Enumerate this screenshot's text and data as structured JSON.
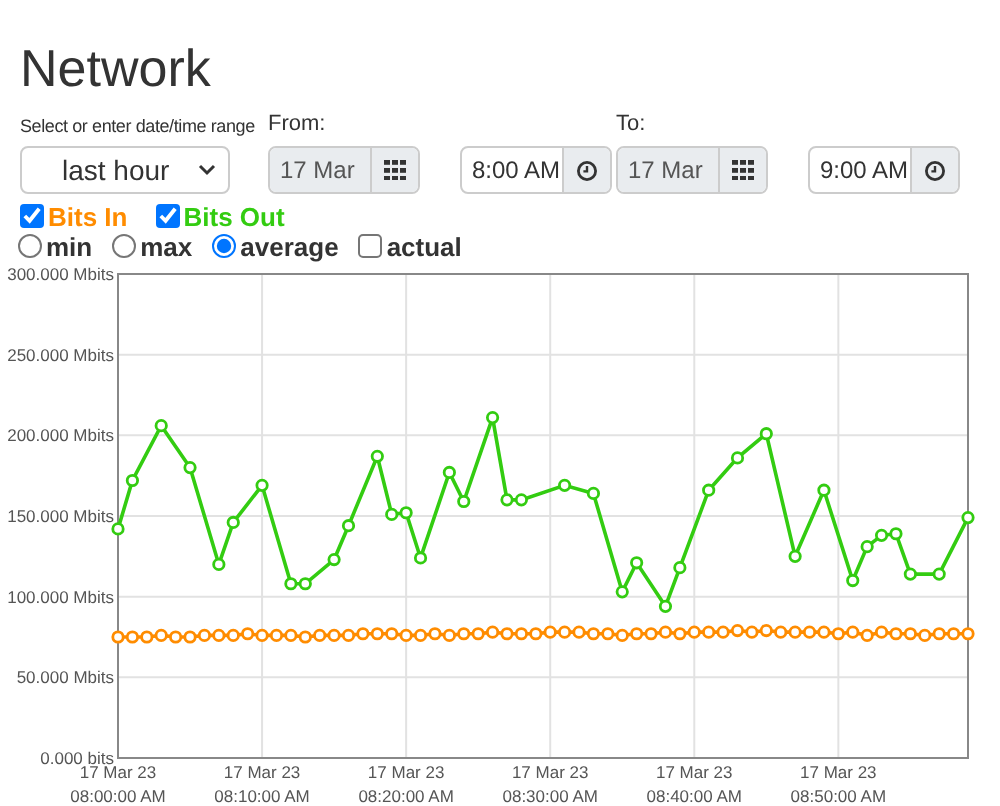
{
  "title": "Network",
  "range": {
    "label": "Select or enter date/time range",
    "value": "last hour"
  },
  "from": {
    "label": "From:",
    "date": "17 Mar",
    "time": "8:00 AM"
  },
  "to": {
    "label": "To:",
    "date": "17 Mar",
    "time": "9:00 AM"
  },
  "series_toggles": [
    {
      "label": "Bits In",
      "checked": true,
      "color": "#ff8c00"
    },
    {
      "label": "Bits Out",
      "checked": true,
      "color": "#33cc11"
    }
  ],
  "modes": [
    {
      "kind": "radio",
      "label": "min",
      "selected": false
    },
    {
      "kind": "radio",
      "label": "max",
      "selected": false
    },
    {
      "kind": "radio",
      "label": "average",
      "selected": true
    },
    {
      "kind": "checkbox",
      "label": "actual",
      "selected": false
    }
  ],
  "chart_data": {
    "type": "line",
    "grid": true,
    "ylim": [
      0,
      300
    ],
    "categories": [
      "17 Mar 23\n08:00:00 AM",
      null,
      null,
      null,
      null,
      null,
      null,
      null,
      null,
      null,
      "17 Mar 23\n08:10:00 AM",
      null,
      null,
      null,
      null,
      null,
      null,
      null,
      null,
      null,
      "17 Mar 23\n08:20:00 AM",
      null,
      null,
      null,
      null,
      null,
      null,
      null,
      null,
      null,
      "17 Mar 23\n08:30:00 AM",
      null,
      null,
      null,
      null,
      null,
      null,
      null,
      null,
      null,
      "17 Mar 23\n08:40:00 AM",
      null,
      null,
      null,
      null,
      null,
      null,
      null,
      null,
      null,
      "17 Mar 23\n08:50:00 AM",
      null,
      null,
      null,
      null,
      null,
      null,
      null,
      null,
      null
    ],
    "yticks": [
      {
        "value": 0,
        "label": "0.000 bits"
      },
      {
        "value": 50,
        "label": "50.000 Mbits"
      },
      {
        "value": 100,
        "label": "100.000 Mbits"
      },
      {
        "value": 150,
        "label": "150.000 Mbits"
      },
      {
        "value": 200,
        "label": "200.000 Mbits"
      },
      {
        "value": 250,
        "label": "250.000 Mbits"
      },
      {
        "value": 300,
        "label": "300.000 Mbits"
      }
    ],
    "series": [
      {
        "color": "#ff8c00",
        "marker": true,
        "values": [
          75,
          75,
          75,
          76,
          75,
          75,
          76,
          76,
          76,
          77,
          76,
          76,
          76,
          75,
          76,
          76,
          76,
          77,
          77,
          77,
          76,
          76,
          77,
          76,
          77,
          77,
          78,
          77,
          77,
          77,
          78,
          78,
          78,
          77,
          77,
          76,
          77,
          77,
          78,
          77,
          78,
          78,
          78,
          79,
          78,
          79,
          78,
          78,
          78,
          78,
          77,
          78,
          76,
          78,
          77,
          77,
          76,
          77,
          77,
          77
        ]
      },
      {
        "color": "#33cc11",
        "marker": true,
        "values": [
          142,
          172,
          null,
          206,
          null,
          180,
          null,
          120,
          146,
          null,
          169,
          null,
          108,
          108,
          null,
          123,
          144,
          null,
          187,
          151,
          152,
          124,
          null,
          177,
          159,
          null,
          211,
          160,
          160,
          null,
          null,
          169,
          null,
          164,
          null,
          103,
          121,
          null,
          94,
          118,
          null,
          166,
          null,
          186,
          null,
          201,
          null,
          125,
          null,
          166,
          null,
          110,
          131,
          138,
          139,
          114,
          null,
          114,
          null,
          149
        ]
      }
    ]
  }
}
